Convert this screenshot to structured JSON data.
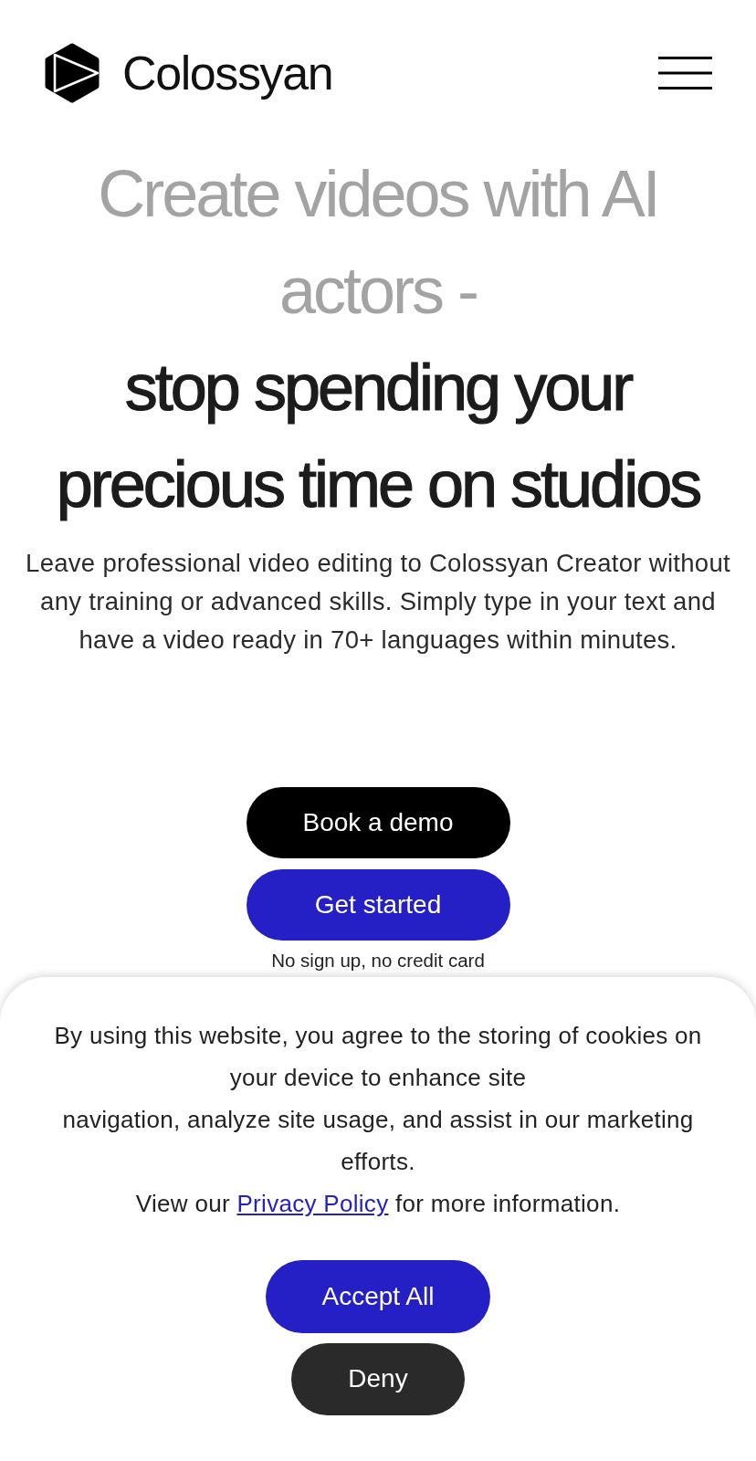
{
  "header": {
    "brand": "Colossyan"
  },
  "hero": {
    "headline": "Create videos with AI actors - **stop spending your precious time on studios**",
    "intro": "Leave professional video editing to Colossyan Creator without any training or advanced skills. Simply type in your text and have a video ready in 70+ languages within minutes.",
    "buttons": [
      {
        "label": "Book a demo",
        "kind": "dark"
      },
      {
        "label": "Get started",
        "kind": "primary"
      }
    ],
    "note": "No sign up, no credit card"
  },
  "cookie_banner": {
    "lines": [
      "By using this website, you agree to the storing of cookies on your device to enhance site",
      "navigation, analyze site usage, and assist in our marketing efforts."
    ],
    "policy_line": {
      "before": "View our",
      "link": "Privacy Policy",
      "after": "for more information."
    },
    "buttons": [
      {
        "label": "Accept All",
        "kind": "primary"
      },
      {
        "label": "Deny",
        "kind": "dark"
      }
    ]
  }
}
